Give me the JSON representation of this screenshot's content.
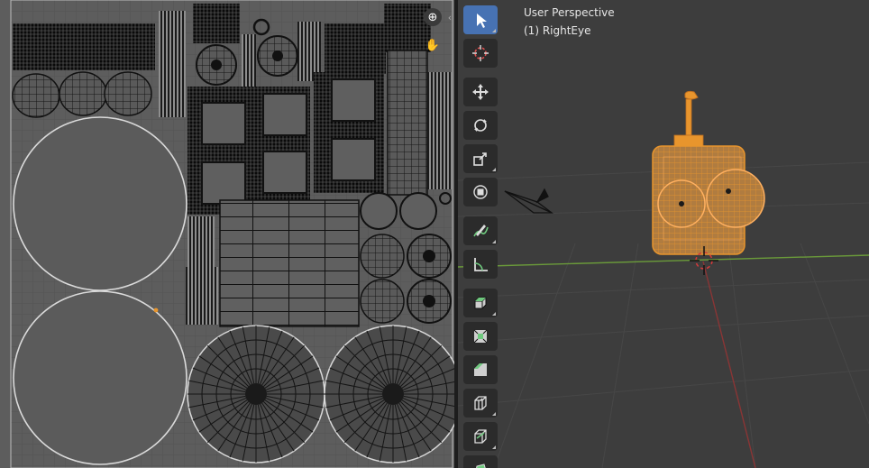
{
  "viewport": {
    "title": "User Perspective",
    "subtitle": "(1) RightEye",
    "colors": {
      "background": "#3d3d3d",
      "selection": "#e8952d",
      "x_axis": "#8a3535",
      "y_axis": "#6a9a3a",
      "active_tool": "#4772b3"
    }
  },
  "uv_editor": {
    "navigation": [
      {
        "name": "zoom-icon",
        "glyph": "⊕"
      },
      {
        "name": "pan-hand-icon",
        "glyph": "✋"
      },
      {
        "name": "collapse-arrow-icon",
        "glyph": "‹"
      }
    ]
  },
  "toolbar": {
    "tools": [
      {
        "name": "select-box",
        "icon": "select-cursor-icon",
        "active": true,
        "corner": true
      },
      {
        "name": "cursor",
        "icon": "3d-cursor-icon",
        "active": false,
        "corner": false
      },
      {
        "name": "move",
        "icon": "move-icon",
        "active": false,
        "corner": false,
        "gap": true
      },
      {
        "name": "rotate",
        "icon": "rotate-icon",
        "active": false,
        "corner": false
      },
      {
        "name": "scale",
        "icon": "scale-icon",
        "active": false,
        "corner": true
      },
      {
        "name": "transform",
        "icon": "transform-icon",
        "active": false,
        "corner": false
      },
      {
        "name": "annotate",
        "icon": "annotate-icon",
        "active": false,
        "corner": true,
        "gap": true
      },
      {
        "name": "measure",
        "icon": "measure-icon",
        "active": false,
        "corner": false
      },
      {
        "name": "extrude-region",
        "icon": "extrude-icon",
        "active": false,
        "corner": true,
        "gap": true
      },
      {
        "name": "inset-faces",
        "icon": "inset-icon",
        "active": false,
        "corner": false
      },
      {
        "name": "bevel",
        "icon": "bevel-icon",
        "active": false,
        "corner": false
      },
      {
        "name": "loop-cut",
        "icon": "loop-cut-icon",
        "active": false,
        "corner": true
      },
      {
        "name": "knife",
        "icon": "knife-icon",
        "active": false,
        "corner": true
      },
      {
        "name": "poly-build",
        "icon": "poly-build-icon",
        "active": false,
        "corner": false
      }
    ]
  }
}
